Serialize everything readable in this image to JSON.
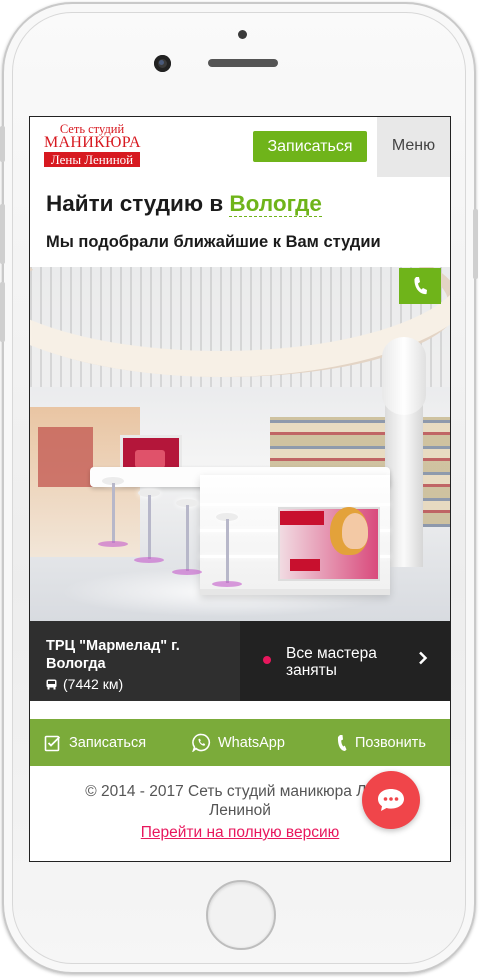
{
  "header": {
    "logo": {
      "line1": "Сеть студий",
      "line2": "МАНИКЮРА",
      "line3": "Лены Лениной"
    },
    "signup_label": "Записаться",
    "menu_label": "Меню"
  },
  "search": {
    "title_prefix": "Найти студию в",
    "city": "Вологде",
    "subtitle": "Мы подобрали ближайшие к Вам студии"
  },
  "studio": {
    "name": "ТРЦ \"Мармелад\" г. Вологда",
    "distance": "(7442 км)",
    "status": "Все мастера заняты",
    "status_color": "#e8175d"
  },
  "actions": [
    {
      "label": "Записаться",
      "icon": "checklist-icon"
    },
    {
      "label": "WhatsApp",
      "icon": "whatsapp-icon"
    },
    {
      "label": "Позвонить",
      "icon": "phone-icon"
    }
  ],
  "footer": {
    "copyright": "© 2014 - 2017 Сеть студий маникюра Лены Лениной",
    "full_version_link": "Перейти на полную версию"
  },
  "colors": {
    "brand_red": "#d71920",
    "accent_green": "#6fb41a",
    "action_bar": "#7bab3a",
    "link_pink": "#e8175d",
    "chat_button": "#f0454a"
  }
}
